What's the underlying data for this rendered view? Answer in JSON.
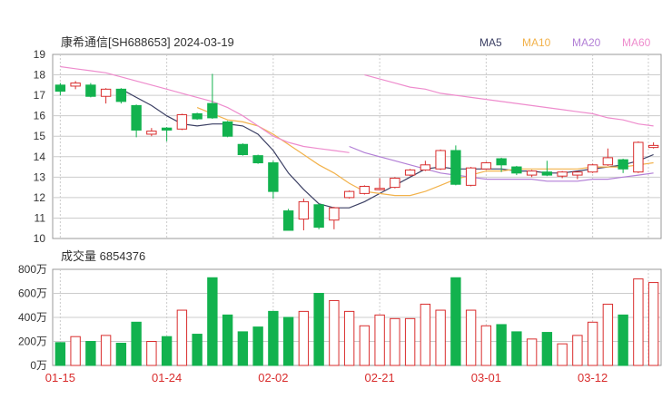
{
  "chart_data": [
    {
      "type": "candlestick",
      "title": "康希通信[SH688653] 2024-03-19",
      "legend": [
        {
          "name": "MA5",
          "color": "#3b3f63"
        },
        {
          "name": "MA10",
          "color": "#f2b24b"
        },
        {
          "name": "MA20",
          "color": "#b27fd6"
        },
        {
          "name": "MA60",
          "color": "#ee8ccd"
        }
      ],
      "ylim": [
        10,
        19
      ],
      "yticks": [
        "19",
        "18",
        "17",
        "16",
        "15",
        "14",
        "13",
        "12",
        "11",
        "10"
      ],
      "colors": {
        "up": "#d92d2d",
        "down": "#12b24e",
        "grid": "#cccccc",
        "axis": "#999999"
      },
      "candles": [
        {
          "o": 17.5,
          "c": 17.2,
          "h": 17.6,
          "l": 17.0
        },
        {
          "o": 17.45,
          "c": 17.6,
          "h": 17.7,
          "l": 17.3
        },
        {
          "o": 17.5,
          "c": 16.95,
          "h": 17.6,
          "l": 16.9
        },
        {
          "o": 16.95,
          "c": 17.3,
          "h": 17.35,
          "l": 16.6
        },
        {
          "o": 17.3,
          "c": 16.7,
          "h": 17.35,
          "l": 16.6
        },
        {
          "o": 16.5,
          "c": 15.3,
          "h": 16.55,
          "l": 14.95
        },
        {
          "o": 15.1,
          "c": 15.25,
          "h": 15.4,
          "l": 15.0
        },
        {
          "o": 15.4,
          "c": 15.3,
          "h": 15.45,
          "l": 14.75
        },
        {
          "o": 15.35,
          "c": 16.05,
          "h": 16.1,
          "l": 15.3
        },
        {
          "o": 16.1,
          "c": 15.85,
          "h": 16.15,
          "l": 15.8
        },
        {
          "o": 16.6,
          "c": 15.9,
          "h": 18.05,
          "l": 15.85
        },
        {
          "o": 15.7,
          "c": 15.0,
          "h": 15.75,
          "l": 14.95
        },
        {
          "o": 14.6,
          "c": 14.1,
          "h": 14.65,
          "l": 14.05
        },
        {
          "o": 14.05,
          "c": 13.7,
          "h": 14.1,
          "l": 13.65
        },
        {
          "o": 13.7,
          "c": 12.3,
          "h": 13.8,
          "l": 11.95
        },
        {
          "o": 11.35,
          "c": 10.4,
          "h": 11.45,
          "l": 10.85
        },
        {
          "o": 10.95,
          "c": 11.8,
          "h": 11.95,
          "l": 10.4
        },
        {
          "o": 11.65,
          "c": 10.55,
          "h": 11.7,
          "l": 10.45
        },
        {
          "o": 10.9,
          "c": 11.5,
          "h": 11.55,
          "l": 10.45
        },
        {
          "o": 12.0,
          "c": 12.3,
          "h": 12.35,
          "l": 11.95
        },
        {
          "o": 12.2,
          "c": 12.55,
          "h": 12.6,
          "l": 12.15
        },
        {
          "o": 12.4,
          "c": 12.45,
          "h": 12.95,
          "l": 12.35
        },
        {
          "o": 12.5,
          "c": 12.95,
          "h": 13.0,
          "l": 12.45
        },
        {
          "o": 13.1,
          "c": 13.35,
          "h": 13.4,
          "l": 13.05
        },
        {
          "o": 13.35,
          "c": 13.6,
          "h": 13.8,
          "l": 13.3
        },
        {
          "o": 13.4,
          "c": 14.3,
          "h": 14.35,
          "l": 13.35
        },
        {
          "o": 14.3,
          "c": 12.65,
          "h": 14.55,
          "l": 12.6
        },
        {
          "o": 12.6,
          "c": 13.45,
          "h": 13.5,
          "l": 12.55
        },
        {
          "o": 13.4,
          "c": 13.7,
          "h": 13.75,
          "l": 13.35
        },
        {
          "o": 13.9,
          "c": 13.6,
          "h": 13.95,
          "l": 13.25
        },
        {
          "o": 13.5,
          "c": 13.2,
          "h": 13.55,
          "l": 13.1
        },
        {
          "o": 13.1,
          "c": 13.3,
          "h": 13.35,
          "l": 13.0
        },
        {
          "o": 13.25,
          "c": 13.1,
          "h": 13.8,
          "l": 13.05
        },
        {
          "o": 13.05,
          "c": 13.25,
          "h": 13.3,
          "l": 12.95
        },
        {
          "o": 13.1,
          "c": 13.25,
          "h": 13.3,
          "l": 12.9
        },
        {
          "o": 13.25,
          "c": 13.6,
          "h": 13.65,
          "l": 13.2
        },
        {
          "o": 13.6,
          "c": 13.95,
          "h": 14.4,
          "l": 13.55
        },
        {
          "o": 13.85,
          "c": 13.4,
          "h": 13.9,
          "l": 13.2
        },
        {
          "o": 13.25,
          "c": 14.7,
          "h": 14.75,
          "l": 13.2
        },
        {
          "o": 14.45,
          "c": 14.55,
          "h": 14.7,
          "l": 14.4
        }
      ],
      "ma": {
        "MA5": [
          null,
          null,
          null,
          null,
          17.3,
          16.9,
          16.5,
          16.0,
          15.6,
          15.5,
          15.6,
          15.6,
          15.5,
          15.1,
          14.3,
          13.2,
          12.4,
          11.7,
          11.5,
          11.5,
          11.8,
          12.2,
          12.6,
          13.0,
          13.4,
          13.5,
          13.4,
          13.4,
          13.4,
          13.4,
          13.3,
          13.3,
          13.2,
          13.2,
          13.3,
          13.4,
          13.5,
          13.6,
          13.8,
          14.1
        ],
        "MA10": [
          null,
          null,
          null,
          null,
          null,
          null,
          null,
          null,
          null,
          16.4,
          16.1,
          15.8,
          15.7,
          15.5,
          15.1,
          14.6,
          14.1,
          13.6,
          13.2,
          12.7,
          12.3,
          12.2,
          12.1,
          12.1,
          12.3,
          12.6,
          12.9,
          13.1,
          13.3,
          13.3,
          13.4,
          13.4,
          13.4,
          13.4,
          13.4,
          13.5,
          13.5,
          13.5,
          13.6,
          13.7
        ],
        "MA20": [
          null,
          null,
          null,
          null,
          null,
          null,
          null,
          null,
          null,
          null,
          null,
          null,
          null,
          null,
          null,
          null,
          null,
          null,
          null,
          14.5,
          14.2,
          14.0,
          13.8,
          13.6,
          13.4,
          13.2,
          13.1,
          13.0,
          12.9,
          12.9,
          12.9,
          12.9,
          12.8,
          12.8,
          12.8,
          12.9,
          12.9,
          13.0,
          13.1,
          13.2
        ],
        "MA60": [
          18.4,
          18.3,
          18.2,
          18.1,
          17.9,
          17.7,
          17.5,
          17.3,
          17.1,
          16.9,
          16.7,
          16.4,
          16.0,
          15.5,
          15.0,
          14.7,
          14.5,
          14.4,
          14.3,
          14.2,
          18.0,
          17.8,
          17.6,
          17.4,
          17.3,
          17.1,
          17.0,
          16.9,
          16.8,
          16.7,
          16.6,
          16.5,
          16.4,
          16.3,
          16.2,
          16.1,
          15.9,
          15.8,
          15.6,
          15.5
        ]
      }
    },
    {
      "type": "bar",
      "title": "成交量 6854376",
      "ylim": [
        0,
        800
      ],
      "yticks": [
        "800万",
        "600万",
        "400万",
        "200万",
        "0万"
      ],
      "values": [
        190,
        240,
        200,
        250,
        185,
        360,
        200,
        240,
        460,
        260,
        730,
        420,
        280,
        320,
        450,
        400,
        450,
        600,
        540,
        450,
        330,
        420,
        390,
        390,
        510,
        460,
        730,
        460,
        330,
        340,
        280,
        220,
        275,
        180,
        250,
        360,
        510,
        420,
        720,
        690
      ],
      "up": [
        false,
        true,
        false,
        true,
        false,
        false,
        true,
        false,
        true,
        false,
        false,
        false,
        false,
        false,
        false,
        false,
        true,
        false,
        true,
        true,
        true,
        true,
        true,
        true,
        true,
        true,
        false,
        true,
        true,
        false,
        false,
        true,
        false,
        true,
        true,
        true,
        true,
        false,
        true,
        true
      ],
      "xticks": [
        {
          "label": "01-15",
          "i": 0
        },
        {
          "label": "01-24",
          "i": 7
        },
        {
          "label": "02-02",
          "i": 14
        },
        {
          "label": "02-21",
          "i": 21
        },
        {
          "label": "03-01",
          "i": 28
        },
        {
          "label": "03-12",
          "i": 35
        }
      ]
    }
  ]
}
